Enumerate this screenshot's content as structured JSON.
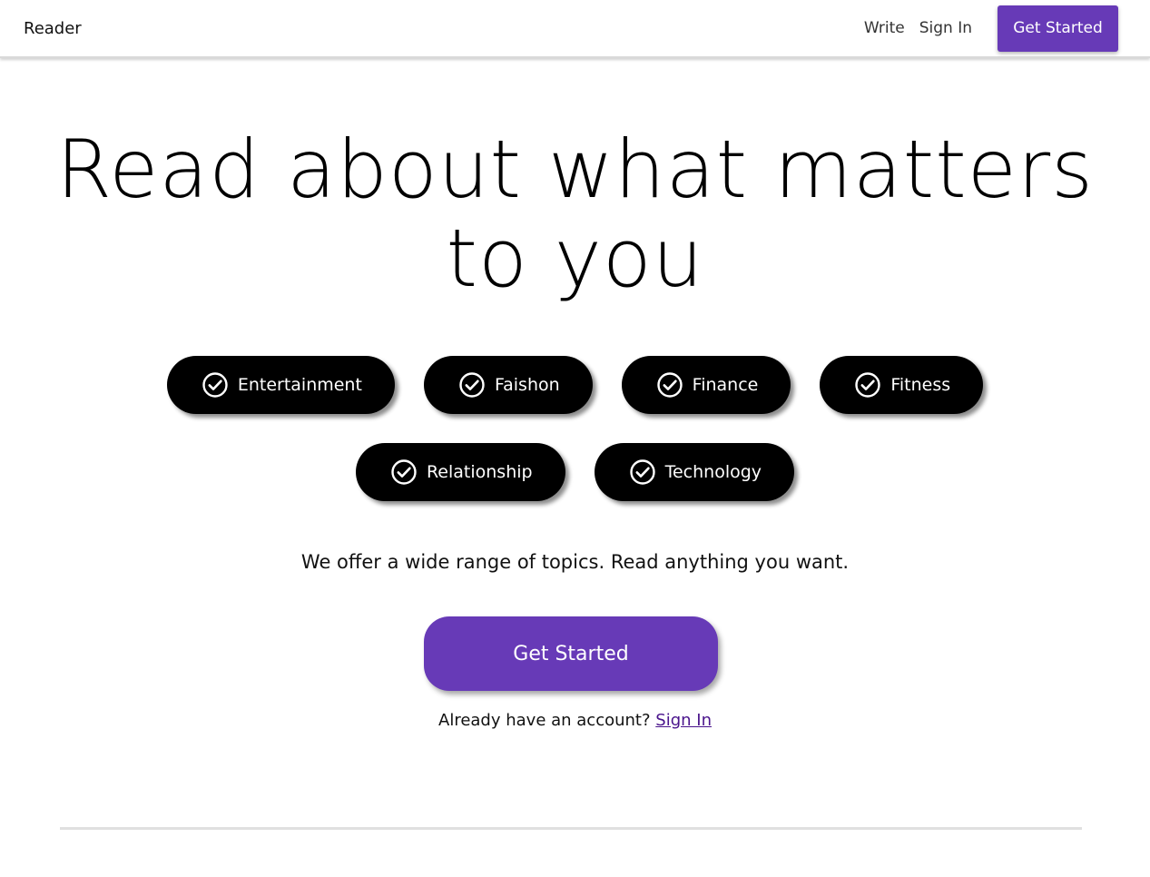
{
  "navbar": {
    "brand": "Reader",
    "write_label": "Write",
    "signin_label": "Sign In",
    "cta_label": "Get Started"
  },
  "hero": {
    "title_line1": "Read about what matters",
    "title_line2": "to you",
    "tagline": "We offer a wide range of topics. Read anything you want.",
    "cta_label": "Get Started",
    "account_prompt": "Already have an account?",
    "account_link": "Sign In"
  },
  "topics": {
    "row1": [
      {
        "label": "Entertainment"
      },
      {
        "label": "Faishon"
      },
      {
        "label": "Finance"
      },
      {
        "label": "Fitness"
      }
    ],
    "row2": [
      {
        "label": "Relationship"
      },
      {
        "label": "Technology"
      }
    ]
  },
  "icons": {
    "topic_icon": "check-circle-icon"
  },
  "colors": {
    "accent": "#673ab7",
    "topic_bg": "#000000",
    "link": "#4a148c"
  }
}
